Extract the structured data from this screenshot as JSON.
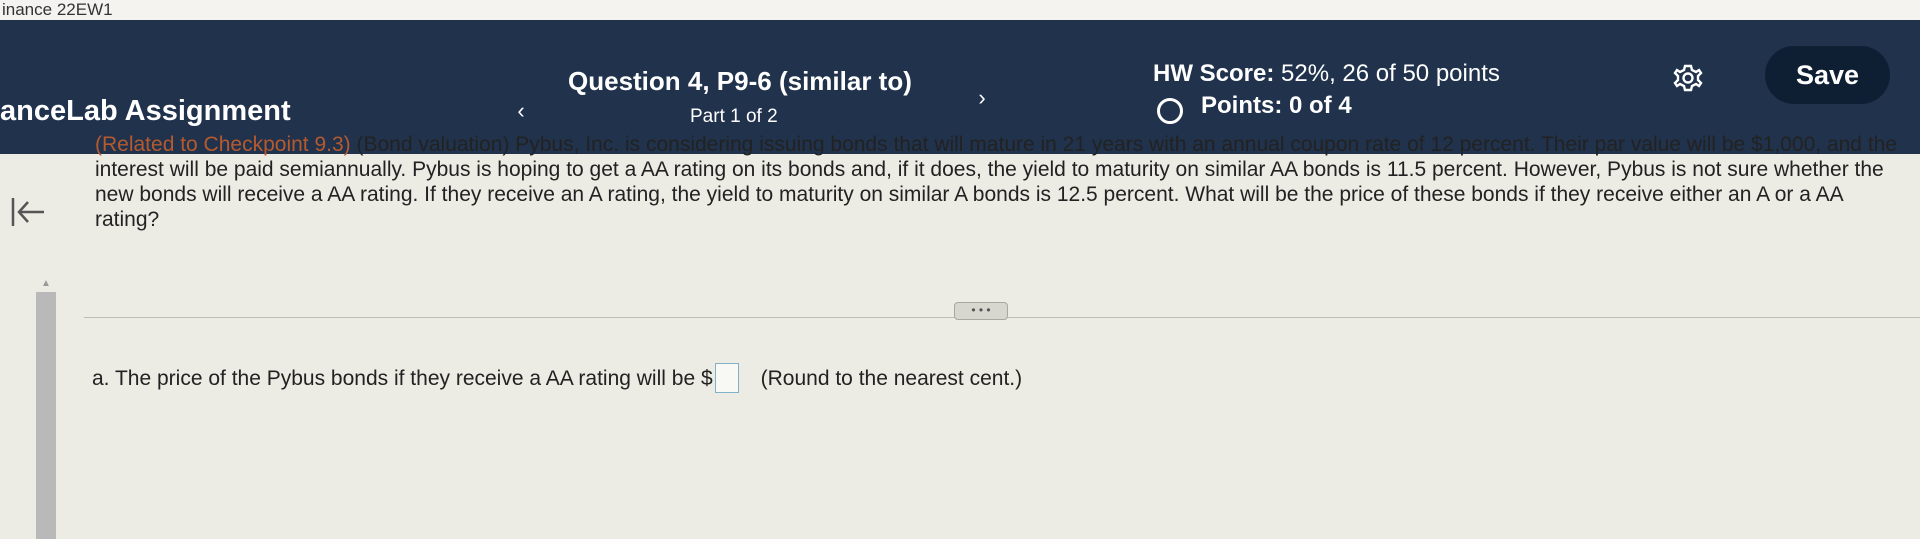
{
  "browser": {
    "tab_fragment": "inance 22EW1"
  },
  "header": {
    "assignment_title": "anceLab Assignment",
    "question_title": "Question 4, P9-6 (similar to)",
    "part_label": "Part 1 of 2",
    "hw_score_label": "HW Score:",
    "hw_score_value": "52%, 26 of 50 points",
    "points_label": "Points: 0 of 4",
    "save_label": "Save",
    "prev_symbol": "‹",
    "next_symbol": "›"
  },
  "question": {
    "reference": "(Related to Checkpoint 9.3)",
    "body": "(Bond valuation)  Pybus, Inc. is considering issuing bonds that will mature in 21 years with an annual coupon rate of 12 percent.  Their par value will be $1,000, and the interest will be paid semiannually.  Pybus is hoping to get a AA rating on its bonds and, if it does, the yield to maturity on similar AA bonds is 11.5 percent. However, Pybus is not sure whether the new bonds will receive a AA rating.  If they receive an A rating, the yield to maturity on similar A bonds is 12.5 percent.  What will be the price of these bonds if they receive either an A or a AA rating?",
    "more_label": "• • •",
    "part_a_prefix": "a.  The price of the Pybus bonds if they receive a AA rating will be $",
    "part_a_suffix": "(Round to the nearest cent.)"
  },
  "colors": {
    "header_bg": "#20324c",
    "save_bg": "#0f1f33",
    "reference_text": "#b55a2e",
    "page_bg": "#ecebe4"
  },
  "icons": [
    "gear-icon",
    "back-arrow-icon",
    "chevron-left-icon",
    "chevron-right-icon",
    "radio-circle-icon"
  ]
}
